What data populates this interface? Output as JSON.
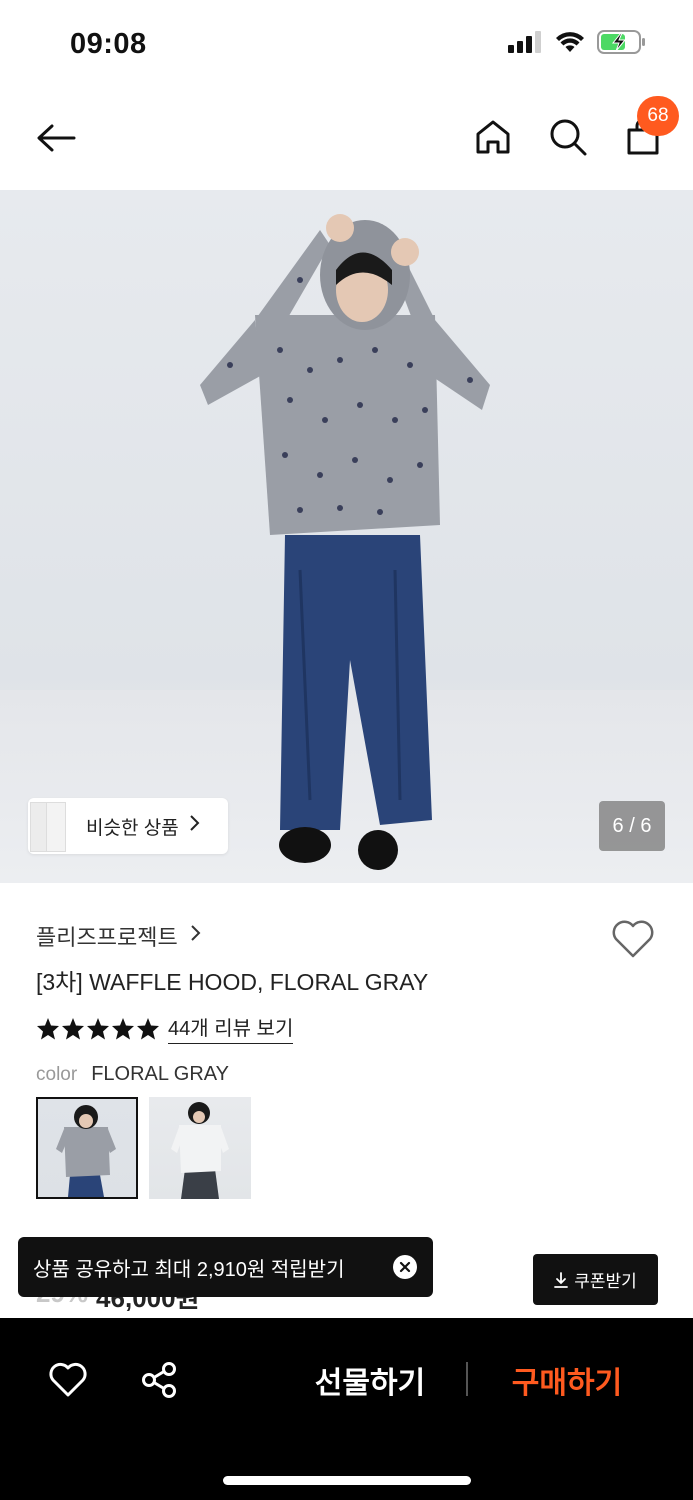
{
  "status_bar": {
    "time": "09:08"
  },
  "header": {
    "cart_count": "68"
  },
  "hero": {
    "similar_label": "비슷한 상품",
    "page_counter": "6 / 6"
  },
  "product": {
    "brand": "플리즈프로젝트",
    "title": "[3차] WAFFLE HOOD, FLORAL GRAY",
    "rating_stars": 5,
    "review_link": "44개 리뷰 보기",
    "color_key": "color",
    "color_value": "FLORAL GRAY",
    "price_discount": "29%",
    "price_value": "46,000원"
  },
  "toast": {
    "text": "상품 공유하고 최대 2,910원 적립받기"
  },
  "coupon": {
    "label": "쿠폰받기"
  },
  "bottom_bar": {
    "gift_label": "선물하기",
    "buy_label": "구매하기"
  },
  "colors": {
    "accent": "#ff5a1f",
    "dark": "#111111"
  }
}
